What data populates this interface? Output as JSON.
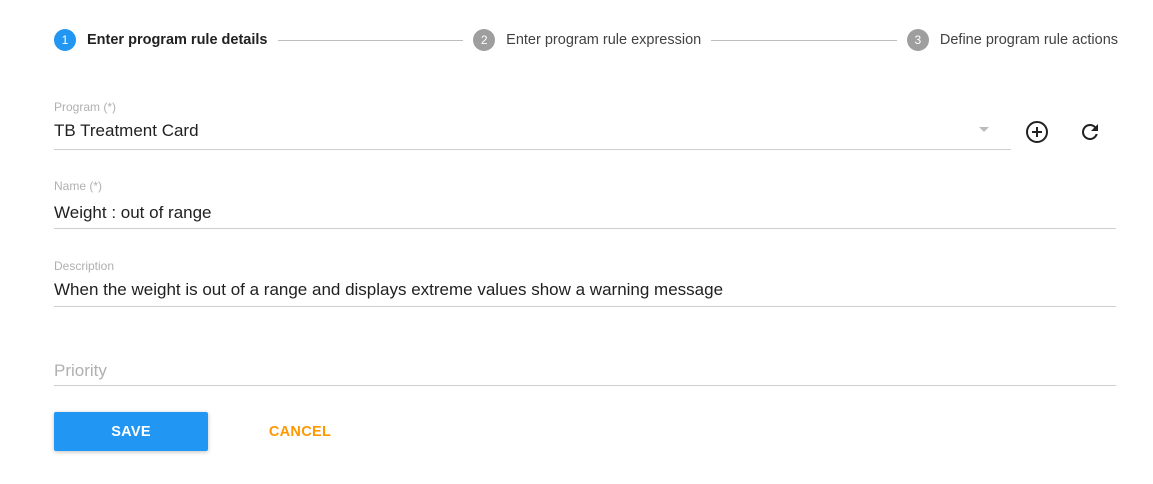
{
  "stepper": {
    "steps": [
      {
        "number": "1",
        "label": "Enter program rule details",
        "state": "active"
      },
      {
        "number": "2",
        "label": "Enter program rule expression",
        "state": "inactive"
      },
      {
        "number": "3",
        "label": "Define program rule actions",
        "state": "inactive"
      }
    ]
  },
  "form": {
    "program": {
      "label": "Program (*)",
      "value": "TB Treatment Card"
    },
    "name": {
      "label": "Name (*)",
      "value": "Weight : out of range"
    },
    "description": {
      "label": "Description",
      "value": "When the weight is out of a range and displays extreme values show a warning message"
    },
    "priority": {
      "placeholder": "Priority",
      "value": ""
    }
  },
  "actions": {
    "save_label": "SAVE",
    "cancel_label": "CANCEL"
  },
  "icons": {
    "add": "add-circle-icon",
    "refresh": "refresh-icon",
    "dropdown": "chevron-down-icon"
  },
  "colors": {
    "primary": "#2196f3",
    "accent": "#ff9800",
    "inactive_step": "#9e9e9e"
  }
}
